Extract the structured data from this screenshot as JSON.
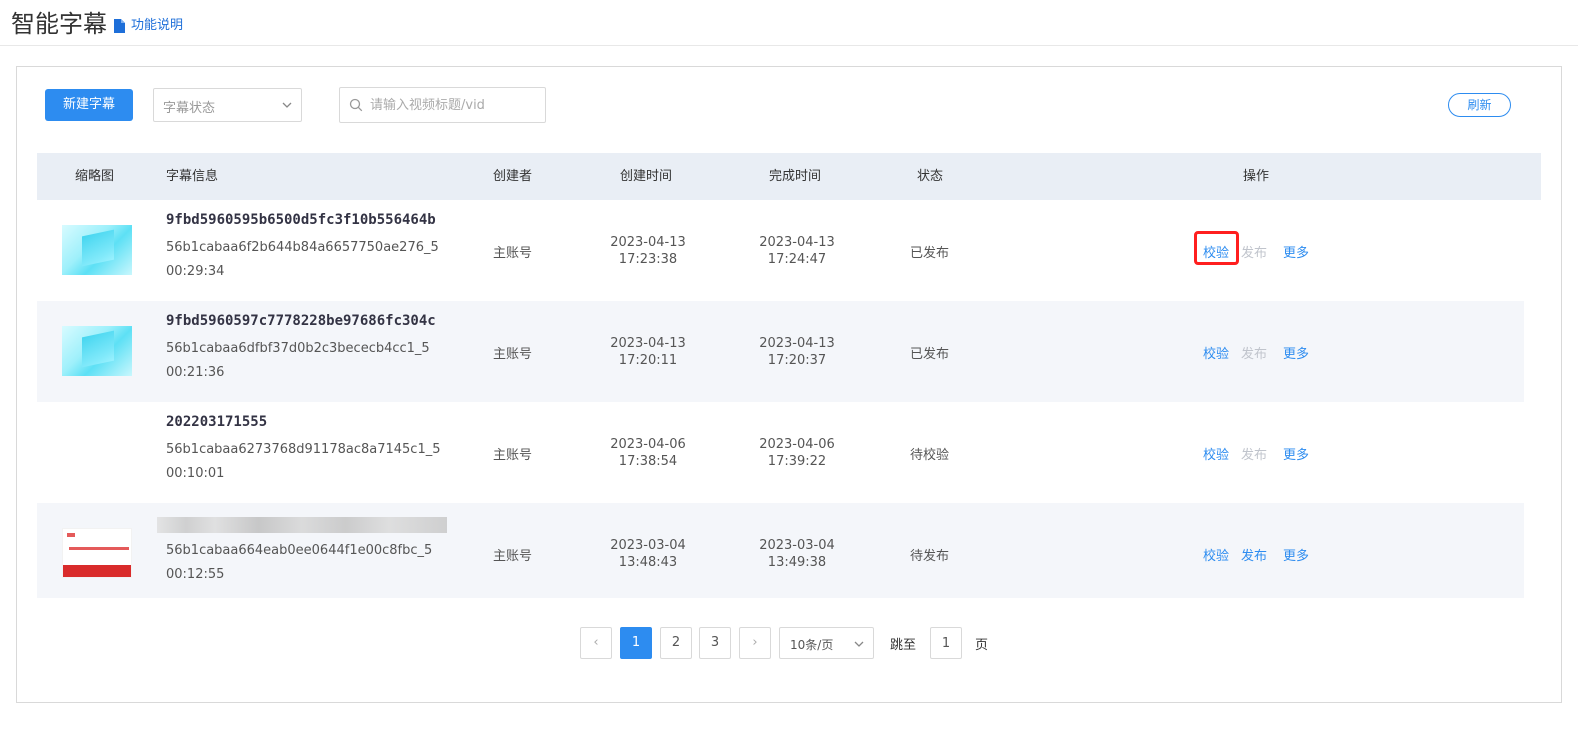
{
  "header": {
    "title": "智能字幕",
    "help_link": "功能说明"
  },
  "toolbar": {
    "new_button": "新建字幕",
    "status_select_placeholder": "字幕状态",
    "search_placeholder": "请输入视频标题/vid",
    "refresh_button": "刷新"
  },
  "table": {
    "columns": {
      "thumbnail": "缩略图",
      "info": "字幕信息",
      "creator": "创建者",
      "created_at": "创建时间",
      "finished_at": "完成时间",
      "status": "状态",
      "actions": "操作"
    },
    "rows": [
      {
        "thumbnail": "cyan",
        "title": "9fbd5960595b6500d5fc3f10b556464b",
        "vid": "56b1cabaa6f2b644b84a6657750ae276_5",
        "duration": "00:29:34",
        "creator": "主账号",
        "created_date": "2023-04-13",
        "created_time": "17:23:38",
        "finished_date": "2023-04-13",
        "finished_time": "17:24:47",
        "status": "已发布",
        "action_verify": "校验",
        "action_publish": "发布",
        "action_more": "更多",
        "publish_enabled": false
      },
      {
        "thumbnail": "cyan",
        "title": "9fbd5960597c7778228be97686fc304c",
        "vid": "56b1cabaa6dfbf37d0b2c3bececb4cc1_5",
        "duration": "00:21:36",
        "creator": "主账号",
        "created_date": "2023-04-13",
        "created_time": "17:20:11",
        "finished_date": "2023-04-13",
        "finished_time": "17:20:37",
        "status": "已发布",
        "action_verify": "校验",
        "action_publish": "发布",
        "action_more": "更多",
        "publish_enabled": false
      },
      {
        "thumbnail": "none",
        "title": "202203171555",
        "vid": "56b1cabaa6273768d91178ac8a7145c1_5",
        "duration": "00:10:01",
        "creator": "主账号",
        "created_date": "2023-04-06",
        "created_time": "17:38:54",
        "finished_date": "2023-04-06",
        "finished_time": "17:39:22",
        "status": "待校验",
        "action_verify": "校验",
        "action_publish": "发布",
        "action_more": "更多",
        "publish_enabled": false
      },
      {
        "thumbnail": "red",
        "title": "",
        "vid": "56b1cabaa664eab0ee0644f1e00c8fbc_5",
        "duration": "00:12:55",
        "creator": "主账号",
        "created_date": "2023-03-04",
        "created_time": "13:48:43",
        "finished_date": "2023-03-04",
        "finished_time": "13:49:38",
        "status": "待发布",
        "action_verify": "校验",
        "action_publish": "发布",
        "action_more": "更多",
        "publish_enabled": true
      }
    ]
  },
  "pagination": {
    "pages": [
      "1",
      "2",
      "3"
    ],
    "current": "1",
    "prev": "‹",
    "next": "›",
    "page_size": "10条/页",
    "jump_label": "跳至",
    "jump_value": "1",
    "jump_suffix": "页"
  },
  "colors": {
    "accent": "#2d8cf0",
    "highlight": "#ff1f1f",
    "header_bg": "#e9eef5",
    "row_alt_bg": "#f4f6fa"
  }
}
